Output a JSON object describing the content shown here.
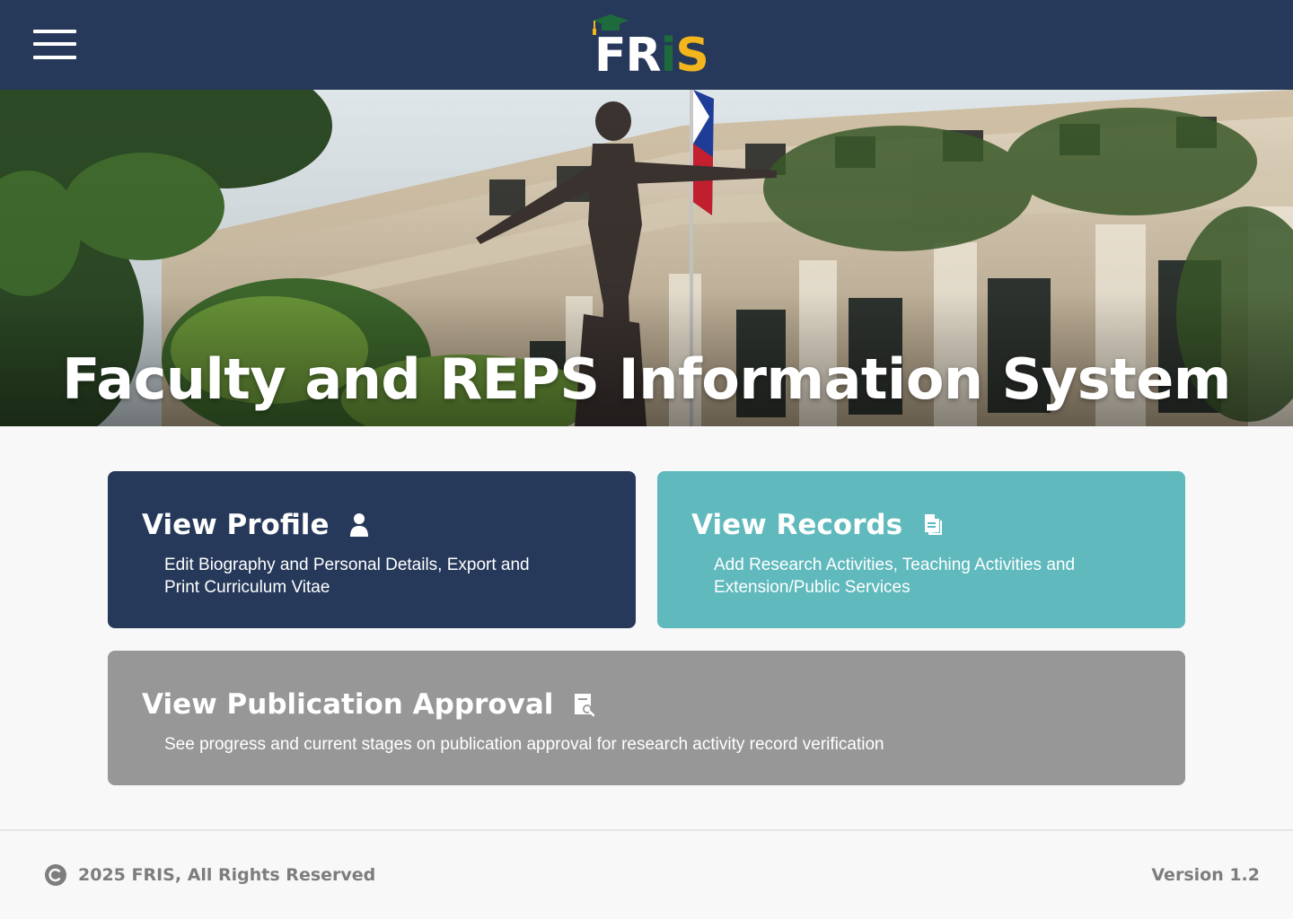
{
  "header": {
    "menu_icon": "hamburger-menu-icon",
    "logo": {
      "part_fr": "FR",
      "part_i": "i",
      "part_s": "S",
      "cap_icon": "graduation-cap-icon"
    }
  },
  "hero": {
    "title": "Faculty and REPS Information System"
  },
  "cards": {
    "profile": {
      "title": "View Profile",
      "icon": "user-icon",
      "description": "Edit Biography and Personal Details, Export and Print Curriculum Vitae",
      "color": "#26395a"
    },
    "records": {
      "title": "View Records",
      "icon": "document-icon",
      "description": "Add Research Activities, Teaching Activities and Extension/Public Services",
      "color": "#5fb9bd"
    },
    "publication": {
      "title": "View Publication Approval",
      "icon": "document-search-icon",
      "description": "See progress and current stages on publication approval for research activity record verification",
      "color": "#979797"
    }
  },
  "footer": {
    "copyright_icon": "copyright-icon",
    "copyright": "2025 FRIS, All Rights Reserved",
    "version": "Version 1.2"
  },
  "colors": {
    "navy": "#26395a",
    "teal": "#5fb9bd",
    "gray": "#979797",
    "logo_green": "#1d6b3c",
    "logo_yellow": "#f2b51b"
  }
}
